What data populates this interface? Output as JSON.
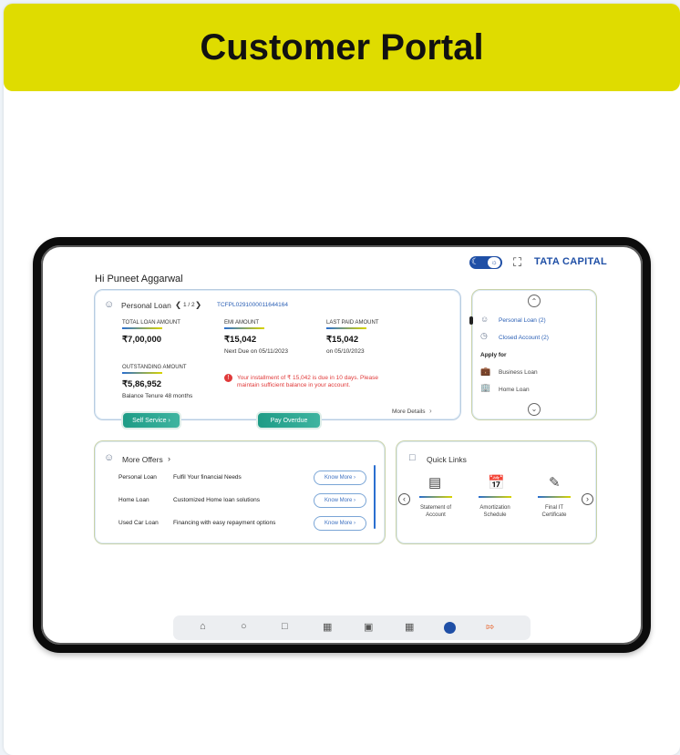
{
  "banner": {
    "title": "Customer Portal"
  },
  "header": {
    "brand": "TATA CAPITAL",
    "greeting": "Hi Puneet Aggarwal",
    "fullscreen_icon": "expand-icon",
    "theme_toggle_icon": "moon-sun-toggle"
  },
  "loan": {
    "type": "Personal Loan",
    "pager": "1 / 2",
    "loan_id": "TCFPL0291000011644164",
    "total_label": "TOTAL LOAN AMOUNT",
    "total_value": "₹7,00,000",
    "emi_label": "EMI AMOUNT",
    "emi_value": "₹15,042",
    "emi_due": "Next Due on 05/11/2023",
    "last_label": "LAST PAID AMOUNT",
    "last_value": "₹15,042",
    "last_date": "on 05/10/2023",
    "out_label": "OUTSTANDING AMOUNT",
    "out_value": "₹5,86,952",
    "out_tenure": "Balance Tenure 48 months",
    "alert_line1": "Your installment of ₹ 15,042 is due in 10 days. Please",
    "alert_line2": "maintain sufficient balance in your account.",
    "more_details": "More Details",
    "self_service": "Self Service",
    "pay_overdue": "Pay Overdue"
  },
  "side": {
    "personal_loan": "Personal Loan (2)",
    "closed_account": "Closed Account (2)",
    "apply_for": "Apply for",
    "business_loan": "Business Loan",
    "home_loan": "Home Loan"
  },
  "offers": {
    "title": "More Offers",
    "rows": [
      {
        "name": "Personal Loan",
        "desc": "Fulfil Your financial Needs",
        "btn": "Know More"
      },
      {
        "name": "Home Loan",
        "desc": "Customized Home loan solutions",
        "btn": "Know More"
      },
      {
        "name": "Used Car Loan",
        "desc": "Financing with easy repayment options",
        "btn": "Know More"
      }
    ]
  },
  "quick_links": {
    "title": "Quick Links",
    "items": [
      {
        "line1": "Statement of",
        "line2": "Account",
        "icon": "statement-icon"
      },
      {
        "line1": "Amortization",
        "line2": "Schedule",
        "icon": "calendar-icon"
      },
      {
        "line1": "Final IT",
        "line2": "Certificate",
        "icon": "certificate-icon"
      }
    ]
  },
  "nav": {
    "icons": [
      "home-icon",
      "circle-icon",
      "chat-icon",
      "folder-icon",
      "document-icon",
      "apps-icon",
      "profile-badge-icon",
      "logout-icon"
    ],
    "badge_color": "#1f4fa6",
    "logout_color": "#e8632a"
  }
}
